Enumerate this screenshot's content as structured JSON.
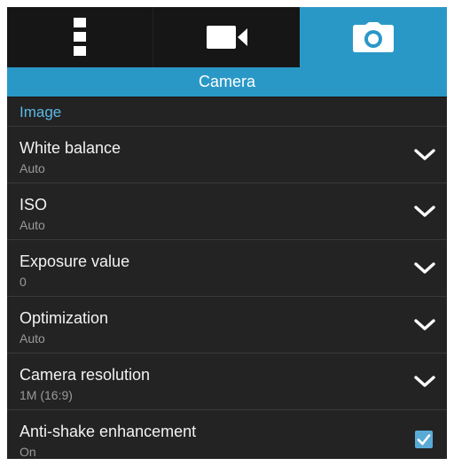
{
  "tabs": [
    {
      "icon": "more-icon",
      "active": false
    },
    {
      "icon": "video-camera-icon",
      "active": false
    },
    {
      "icon": "camera-icon",
      "active": true
    }
  ],
  "header": {
    "title": "Camera"
  },
  "section": {
    "title": "Image"
  },
  "settings": [
    {
      "label": "White balance",
      "value": "Auto",
      "control": "chevron-down-icon"
    },
    {
      "label": "ISO",
      "value": "Auto",
      "control": "chevron-down-icon"
    },
    {
      "label": "Exposure value",
      "value": "0",
      "control": "chevron-down-icon"
    },
    {
      "label": "Optimization",
      "value": "Auto",
      "control": "chevron-down-icon"
    },
    {
      "label": "Camera resolution",
      "value": "1M (16:9)",
      "control": "chevron-down-icon"
    },
    {
      "label": "Anti-shake enhancement",
      "value": "On",
      "control": "checkbox-checked-icon",
      "checked": true
    }
  ],
  "colors": {
    "accent": "#2a98c7",
    "background": "#232323",
    "tab_background": "#161616",
    "section_text": "#5ab9e6",
    "checkbox": "#5aaad6"
  }
}
